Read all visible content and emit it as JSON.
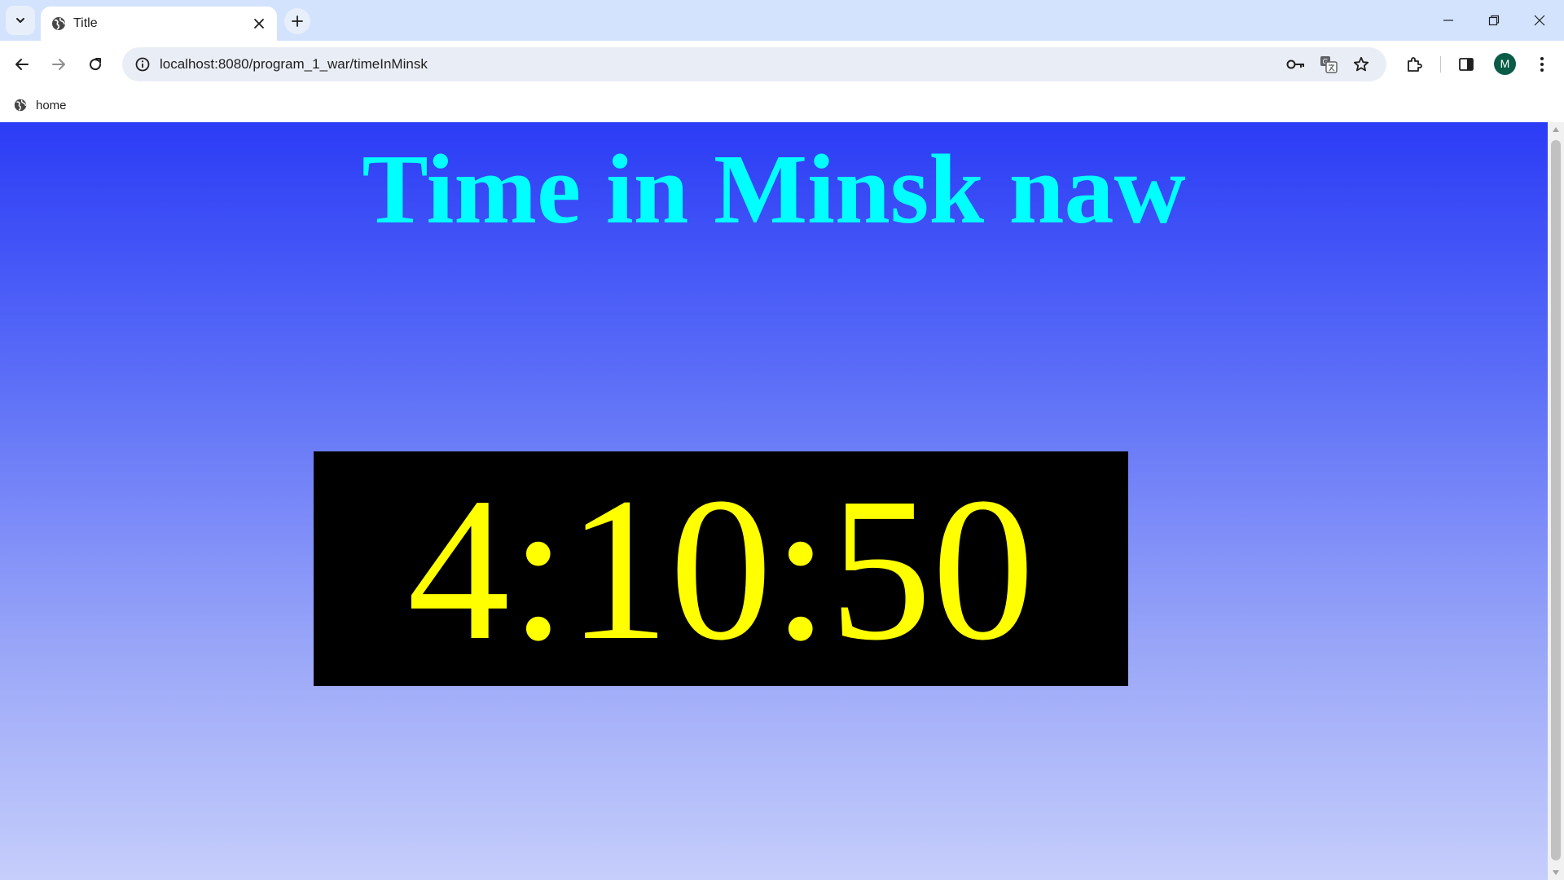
{
  "browser": {
    "tab": {
      "title": "Title"
    },
    "address_bar": {
      "url": "localhost:8080/program_1_war/timeInMinsk"
    },
    "profile": {
      "initial": "M",
      "color": "#0b5c46"
    },
    "bookmarks": [
      {
        "label": "home"
      }
    ]
  },
  "page": {
    "heading": "Time in Minsk naw",
    "clock": {
      "time": "4:10:50"
    },
    "colors": {
      "heading": "#00ffff",
      "clock_text": "#ffff00",
      "clock_background": "#000000",
      "gradient_top": "#2b3cf6",
      "gradient_bottom": "#c6cefb"
    }
  },
  "icons": [
    "chevron-down-icon",
    "globe-icon",
    "close-icon",
    "plus-icon",
    "minimize-icon",
    "restore-icon",
    "window-close-icon",
    "back-arrow-icon",
    "forward-arrow-icon",
    "reload-icon",
    "info-icon",
    "key-icon",
    "translate-icon",
    "star-icon",
    "puzzle-icon",
    "side-panel-icon",
    "kebab-menu-icon"
  ]
}
